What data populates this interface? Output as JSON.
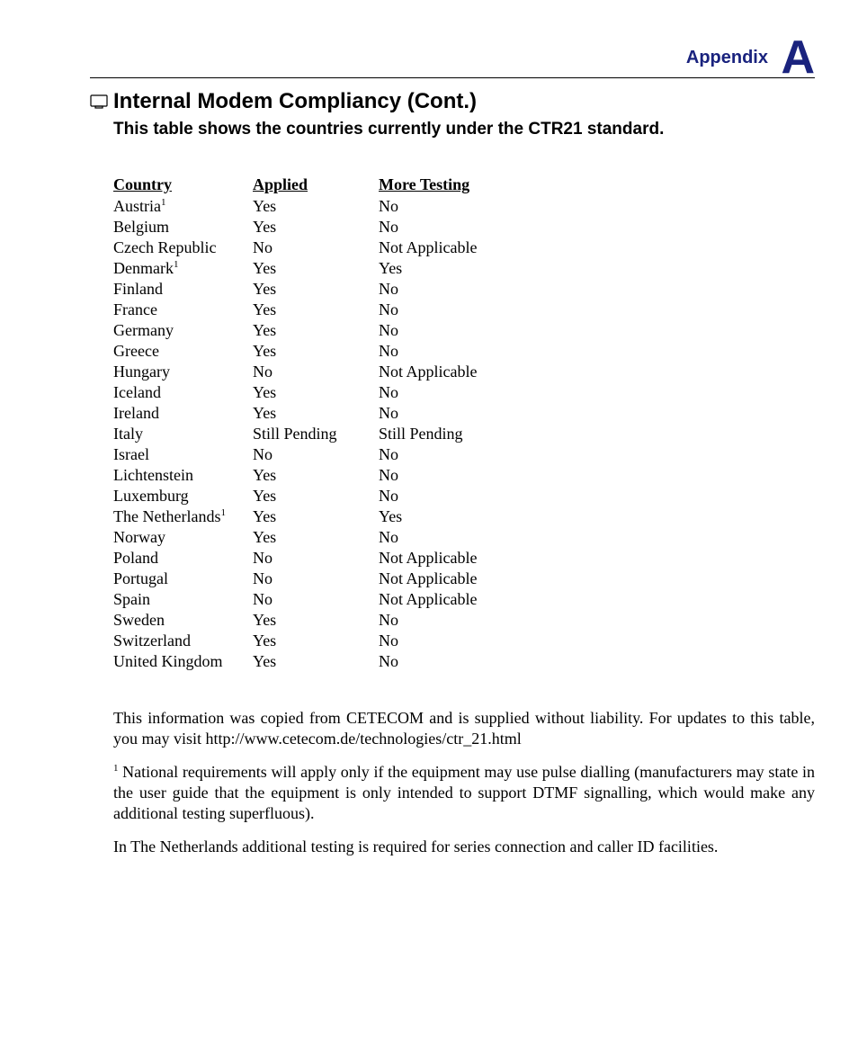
{
  "header": {
    "appendix_label": "Appendix",
    "appendix_letter": "A"
  },
  "title": "Internal Modem Compliancy (Cont.)",
  "subtitle": "This table shows the countries currently under the CTR21 standard.",
  "table": {
    "headers": {
      "country": "Country",
      "applied": "Applied",
      "more": "More Testing"
    },
    "rows": [
      {
        "country": "Austria",
        "sup": "1",
        "applied": "Yes",
        "more": "No"
      },
      {
        "country": "Belgium",
        "sup": "",
        "applied": "Yes",
        "more": "No"
      },
      {
        "country": "Czech Republic",
        "sup": "",
        "applied": "No",
        "more": "Not Applicable"
      },
      {
        "country": "Denmark",
        "sup": "1",
        "applied": "Yes",
        "more": "Yes"
      },
      {
        "country": "Finland",
        "sup": "",
        "applied": "Yes",
        "more": "No"
      },
      {
        "country": "France",
        "sup": "",
        "applied": "Yes",
        "more": "No"
      },
      {
        "country": "Germany",
        "sup": "",
        "applied": "Yes",
        "more": "No"
      },
      {
        "country": "Greece",
        "sup": "",
        "applied": "Yes",
        "more": "No"
      },
      {
        "country": "Hungary",
        "sup": "",
        "applied": "No",
        "more": "Not Applicable"
      },
      {
        "country": "Iceland",
        "sup": "",
        "applied": "Yes",
        "more": "No"
      },
      {
        "country": "Ireland",
        "sup": "",
        "applied": "Yes",
        "more": "No"
      },
      {
        "country": "Italy",
        "sup": "",
        "applied": "Still Pending",
        "more": "Still Pending"
      },
      {
        "country": "Israel",
        "sup": "",
        "applied": "No",
        "more": "No"
      },
      {
        "country": "Lichtenstein",
        "sup": "",
        "applied": "Yes",
        "more": "No"
      },
      {
        "country": "Luxemburg",
        "sup": "",
        "applied": "Yes",
        "more": "No"
      },
      {
        "country": "The Netherlands",
        "sup": "1",
        "applied": "Yes",
        "more": "Yes"
      },
      {
        "country": "Norway",
        "sup": "",
        "applied": "Yes",
        "more": "No"
      },
      {
        "country": "Poland",
        "sup": "",
        "applied": "No",
        "more": "Not Applicable"
      },
      {
        "country": "Portugal",
        "sup": "",
        "applied": "No",
        "more": "Not Applicable"
      },
      {
        "country": "Spain",
        "sup": "",
        "applied": "No",
        "more": "Not Applicable"
      },
      {
        "country": "Sweden",
        "sup": "",
        "applied": "Yes",
        "more": "No"
      },
      {
        "country": "Switzerland",
        "sup": "",
        "applied": "Yes",
        "more": "No"
      },
      {
        "country": "United Kingdom",
        "sup": "",
        "applied": "Yes",
        "more": "No"
      }
    ]
  },
  "notes": {
    "p1": "This information was copied from CETECOM and is supplied without liability. For updates to this table, you may visit http://www.cetecom.de/technologies/ctr_21.html",
    "p2_sup": "1",
    "p2": " National requirements will apply only if the equipment may use pulse dialling (manufacturers may state in the user guide that the equipment is only intended to support DTMF signalling, which would make any additional testing superfluous).",
    "p3": "In The Netherlands additional testing is required for series connection and caller ID facilities."
  }
}
